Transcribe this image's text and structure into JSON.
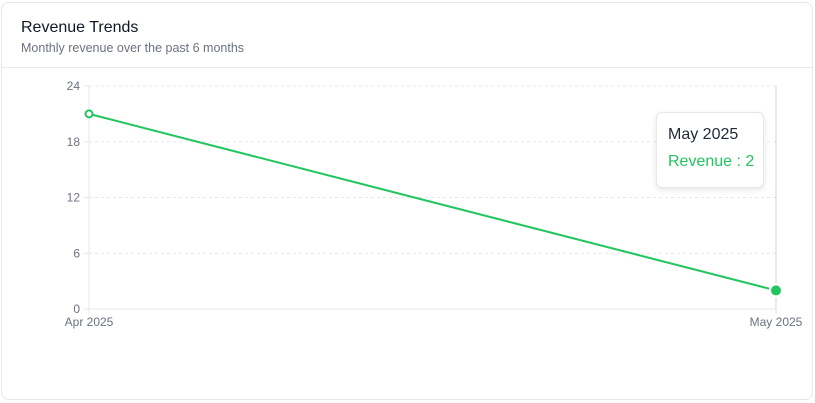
{
  "card": {
    "title": "Revenue Trends",
    "subtitle": "Monthly revenue over the past 6 months"
  },
  "colors": {
    "line": "#22c55e",
    "grid": "#e5e7eb",
    "text_muted": "#6b7280"
  },
  "tooltip": {
    "title": "May 2025",
    "series_label": "Revenue",
    "separator": " : ",
    "value": "2"
  },
  "chart_data": {
    "type": "line",
    "title": "",
    "xlabel": "",
    "ylabel": "",
    "categories": [
      "Apr 2025",
      "May 2025"
    ],
    "series": [
      {
        "name": "Revenue",
        "values": [
          21,
          2
        ]
      }
    ],
    "ylim": [
      0,
      24
    ],
    "yticks": [
      0,
      6,
      12,
      18,
      24
    ],
    "grid": true,
    "active_index": 1
  }
}
